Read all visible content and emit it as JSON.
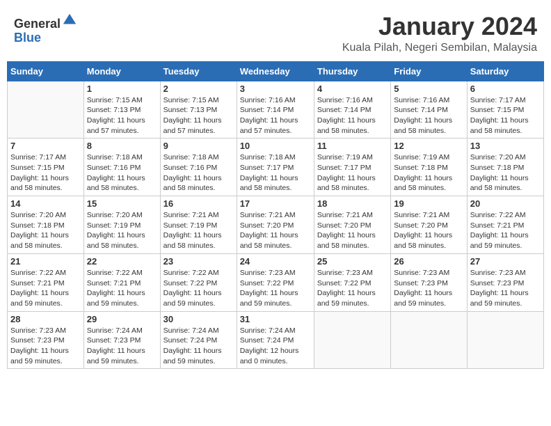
{
  "header": {
    "logo_line1": "General",
    "logo_line2": "Blue",
    "title": "January 2024",
    "subtitle": "Kuala Pilah, Negeri Sembilan, Malaysia"
  },
  "days_of_week": [
    "Sunday",
    "Monday",
    "Tuesday",
    "Wednesday",
    "Thursday",
    "Friday",
    "Saturday"
  ],
  "weeks": [
    [
      {
        "day": "",
        "sunrise": "",
        "sunset": "",
        "daylight": ""
      },
      {
        "day": "1",
        "sunrise": "Sunrise: 7:15 AM",
        "sunset": "Sunset: 7:13 PM",
        "daylight": "Daylight: 11 hours and 57 minutes."
      },
      {
        "day": "2",
        "sunrise": "Sunrise: 7:15 AM",
        "sunset": "Sunset: 7:13 PM",
        "daylight": "Daylight: 11 hours and 57 minutes."
      },
      {
        "day": "3",
        "sunrise": "Sunrise: 7:16 AM",
        "sunset": "Sunset: 7:14 PM",
        "daylight": "Daylight: 11 hours and 57 minutes."
      },
      {
        "day": "4",
        "sunrise": "Sunrise: 7:16 AM",
        "sunset": "Sunset: 7:14 PM",
        "daylight": "Daylight: 11 hours and 58 minutes."
      },
      {
        "day": "5",
        "sunrise": "Sunrise: 7:16 AM",
        "sunset": "Sunset: 7:14 PM",
        "daylight": "Daylight: 11 hours and 58 minutes."
      },
      {
        "day": "6",
        "sunrise": "Sunrise: 7:17 AM",
        "sunset": "Sunset: 7:15 PM",
        "daylight": "Daylight: 11 hours and 58 minutes."
      }
    ],
    [
      {
        "day": "7",
        "sunrise": "Sunrise: 7:17 AM",
        "sunset": "Sunset: 7:15 PM",
        "daylight": "Daylight: 11 hours and 58 minutes."
      },
      {
        "day": "8",
        "sunrise": "Sunrise: 7:18 AM",
        "sunset": "Sunset: 7:16 PM",
        "daylight": "Daylight: 11 hours and 58 minutes."
      },
      {
        "day": "9",
        "sunrise": "Sunrise: 7:18 AM",
        "sunset": "Sunset: 7:16 PM",
        "daylight": "Daylight: 11 hours and 58 minutes."
      },
      {
        "day": "10",
        "sunrise": "Sunrise: 7:18 AM",
        "sunset": "Sunset: 7:17 PM",
        "daylight": "Daylight: 11 hours and 58 minutes."
      },
      {
        "day": "11",
        "sunrise": "Sunrise: 7:19 AM",
        "sunset": "Sunset: 7:17 PM",
        "daylight": "Daylight: 11 hours and 58 minutes."
      },
      {
        "day": "12",
        "sunrise": "Sunrise: 7:19 AM",
        "sunset": "Sunset: 7:18 PM",
        "daylight": "Daylight: 11 hours and 58 minutes."
      },
      {
        "day": "13",
        "sunrise": "Sunrise: 7:20 AM",
        "sunset": "Sunset: 7:18 PM",
        "daylight": "Daylight: 11 hours and 58 minutes."
      }
    ],
    [
      {
        "day": "14",
        "sunrise": "Sunrise: 7:20 AM",
        "sunset": "Sunset: 7:18 PM",
        "daylight": "Daylight: 11 hours and 58 minutes."
      },
      {
        "day": "15",
        "sunrise": "Sunrise: 7:20 AM",
        "sunset": "Sunset: 7:19 PM",
        "daylight": "Daylight: 11 hours and 58 minutes."
      },
      {
        "day": "16",
        "sunrise": "Sunrise: 7:21 AM",
        "sunset": "Sunset: 7:19 PM",
        "daylight": "Daylight: 11 hours and 58 minutes."
      },
      {
        "day": "17",
        "sunrise": "Sunrise: 7:21 AM",
        "sunset": "Sunset: 7:20 PM",
        "daylight": "Daylight: 11 hours and 58 minutes."
      },
      {
        "day": "18",
        "sunrise": "Sunrise: 7:21 AM",
        "sunset": "Sunset: 7:20 PM",
        "daylight": "Daylight: 11 hours and 58 minutes."
      },
      {
        "day": "19",
        "sunrise": "Sunrise: 7:21 AM",
        "sunset": "Sunset: 7:20 PM",
        "daylight": "Daylight: 11 hours and 58 minutes."
      },
      {
        "day": "20",
        "sunrise": "Sunrise: 7:22 AM",
        "sunset": "Sunset: 7:21 PM",
        "daylight": "Daylight: 11 hours and 59 minutes."
      }
    ],
    [
      {
        "day": "21",
        "sunrise": "Sunrise: 7:22 AM",
        "sunset": "Sunset: 7:21 PM",
        "daylight": "Daylight: 11 hours and 59 minutes."
      },
      {
        "day": "22",
        "sunrise": "Sunrise: 7:22 AM",
        "sunset": "Sunset: 7:21 PM",
        "daylight": "Daylight: 11 hours and 59 minutes."
      },
      {
        "day": "23",
        "sunrise": "Sunrise: 7:22 AM",
        "sunset": "Sunset: 7:22 PM",
        "daylight": "Daylight: 11 hours and 59 minutes."
      },
      {
        "day": "24",
        "sunrise": "Sunrise: 7:23 AM",
        "sunset": "Sunset: 7:22 PM",
        "daylight": "Daylight: 11 hours and 59 minutes."
      },
      {
        "day": "25",
        "sunrise": "Sunrise: 7:23 AM",
        "sunset": "Sunset: 7:22 PM",
        "daylight": "Daylight: 11 hours and 59 minutes."
      },
      {
        "day": "26",
        "sunrise": "Sunrise: 7:23 AM",
        "sunset": "Sunset: 7:23 PM",
        "daylight": "Daylight: 11 hours and 59 minutes."
      },
      {
        "day": "27",
        "sunrise": "Sunrise: 7:23 AM",
        "sunset": "Sunset: 7:23 PM",
        "daylight": "Daylight: 11 hours and 59 minutes."
      }
    ],
    [
      {
        "day": "28",
        "sunrise": "Sunrise: 7:23 AM",
        "sunset": "Sunset: 7:23 PM",
        "daylight": "Daylight: 11 hours and 59 minutes."
      },
      {
        "day": "29",
        "sunrise": "Sunrise: 7:24 AM",
        "sunset": "Sunset: 7:23 PM",
        "daylight": "Daylight: 11 hours and 59 minutes."
      },
      {
        "day": "30",
        "sunrise": "Sunrise: 7:24 AM",
        "sunset": "Sunset: 7:24 PM",
        "daylight": "Daylight: 11 hours and 59 minutes."
      },
      {
        "day": "31",
        "sunrise": "Sunrise: 7:24 AM",
        "sunset": "Sunset: 7:24 PM",
        "daylight": "Daylight: 12 hours and 0 minutes."
      },
      {
        "day": "",
        "sunrise": "",
        "sunset": "",
        "daylight": ""
      },
      {
        "day": "",
        "sunrise": "",
        "sunset": "",
        "daylight": ""
      },
      {
        "day": "",
        "sunrise": "",
        "sunset": "",
        "daylight": ""
      }
    ]
  ]
}
